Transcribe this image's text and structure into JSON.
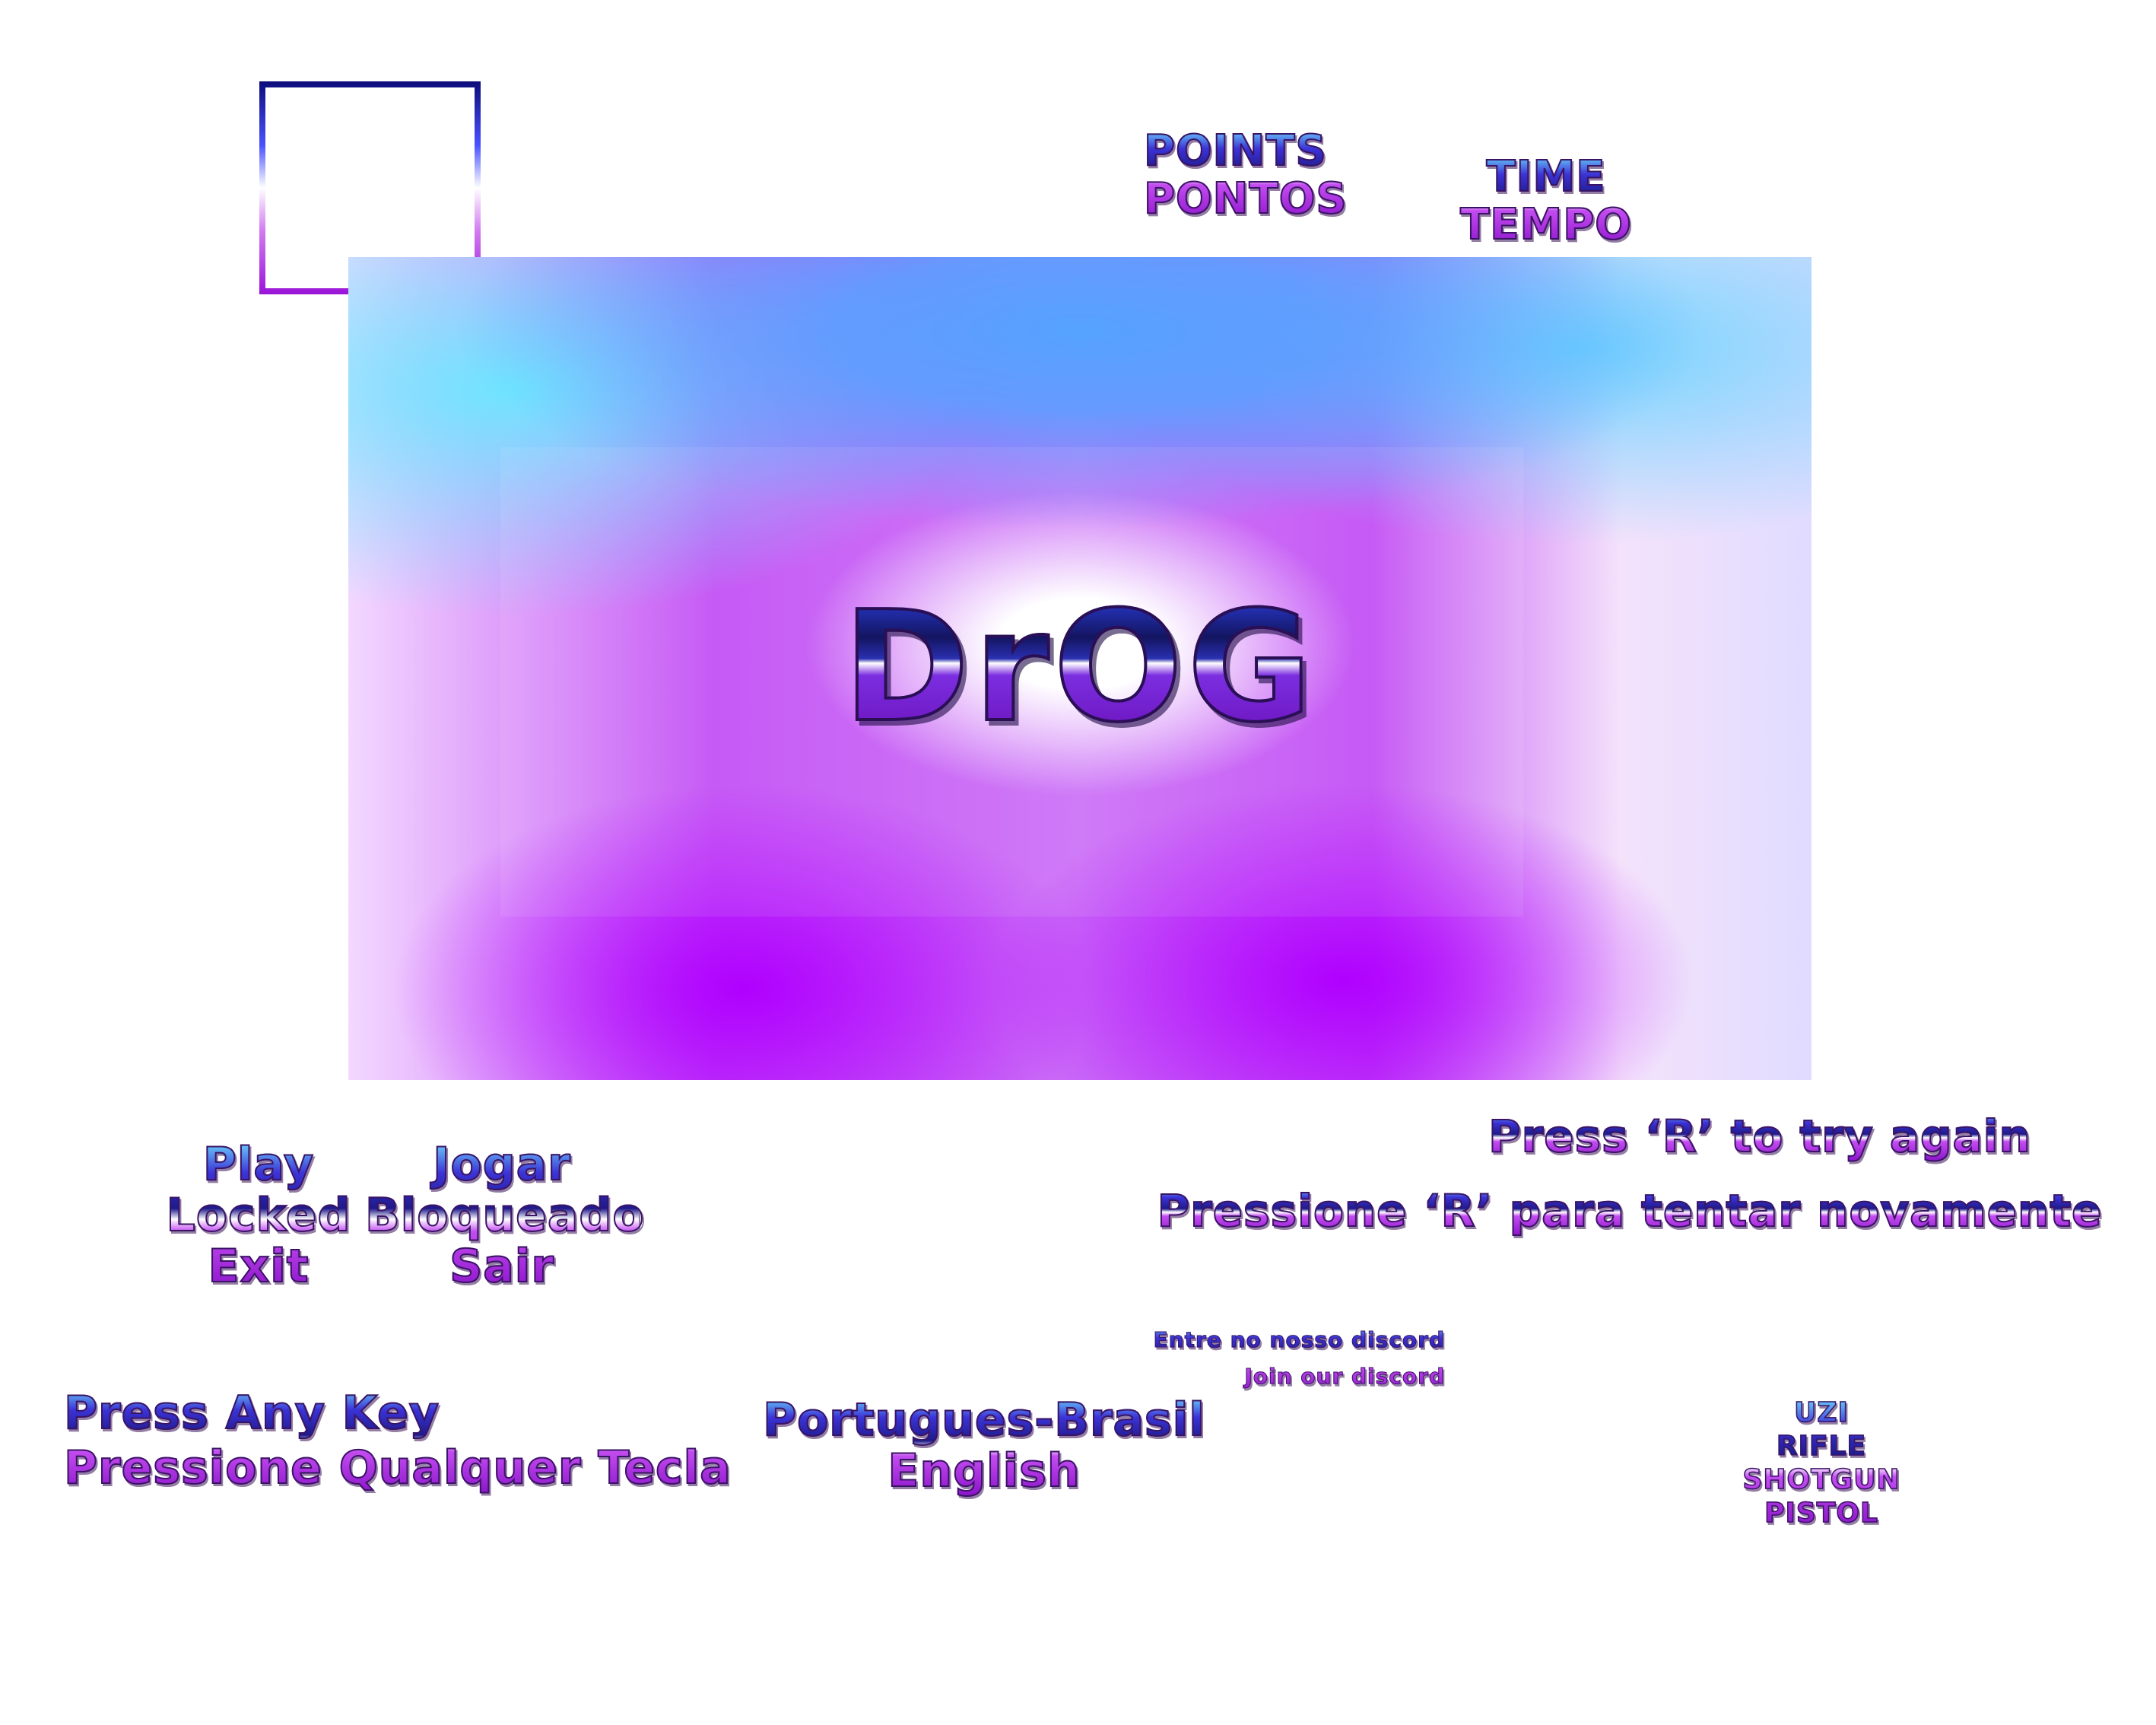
{
  "title": "DrOG",
  "hud": {
    "points_en": "POINTS",
    "points_pt": "PONTOS",
    "time_en": "TIME",
    "time_pt": "TEMPO"
  },
  "menu_en": [
    "Play",
    "Locked",
    "Exit"
  ],
  "menu_pt": [
    "Jogar",
    "Bloqueado",
    "Sair"
  ],
  "press_any_key": {
    "en": "Press Any Key",
    "pt": "Pressione Qualquer Tecla"
  },
  "languages": [
    "Portugues-Brasil",
    "English"
  ],
  "discord": {
    "pt": "Entre no nosso discord",
    "en": "Join our discord"
  },
  "retry": {
    "en": "Press ‘R’ to try again",
    "pt": "Pressione ‘R’ para tentar novamente"
  },
  "weapons": [
    "UZI",
    "RIFLE",
    "SHOTGUN",
    "PISTOL"
  ],
  "colors": {
    "frame_dark": "#0c0c7a",
    "frame_purple": "#9a14d8",
    "panel_blue": "#55a2ff",
    "panel_cyan": "#6fe6ff",
    "panel_purple": "#b000ff"
  }
}
